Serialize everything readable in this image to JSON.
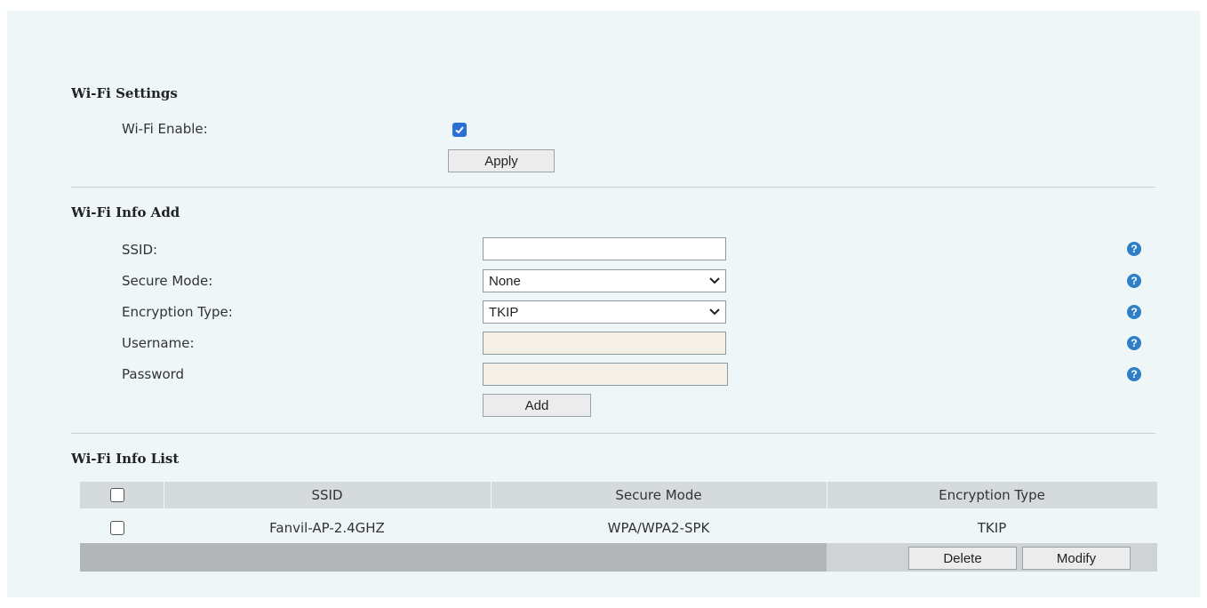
{
  "wifi_settings": {
    "title": "Wi-Fi Settings",
    "enable_label": "Wi-Fi Enable:",
    "enable_checked": true,
    "apply_label": "Apply"
  },
  "wifi_info_add": {
    "title": "Wi-Fi Info Add",
    "ssid_label": "SSID:",
    "ssid_value": "",
    "secure_mode_label": "Secure Mode:",
    "secure_mode_value": "None",
    "encryption_type_label": "Encryption Type:",
    "encryption_type_value": "TKIP",
    "username_label": "Username:",
    "password_label": "Password",
    "add_label": "Add",
    "help_icon": "question-circle-icon",
    "help_glyph": "?"
  },
  "wifi_info_list": {
    "title": "Wi-Fi Info List",
    "columns": [
      "SSID",
      "Secure Mode",
      "Encryption Type"
    ],
    "rows": [
      {
        "ssid": "Fanvil-AP-2.4GHZ",
        "secure_mode": "WPA/WPA2-SPK",
        "encryption_type": "TKIP",
        "checked": false
      }
    ],
    "delete_label": "Delete",
    "modify_label": "Modify"
  },
  "colors": {
    "panel_bg": "#eef6f7",
    "accent": "#2f7fc7",
    "checkbox": "#2a6fd6"
  }
}
